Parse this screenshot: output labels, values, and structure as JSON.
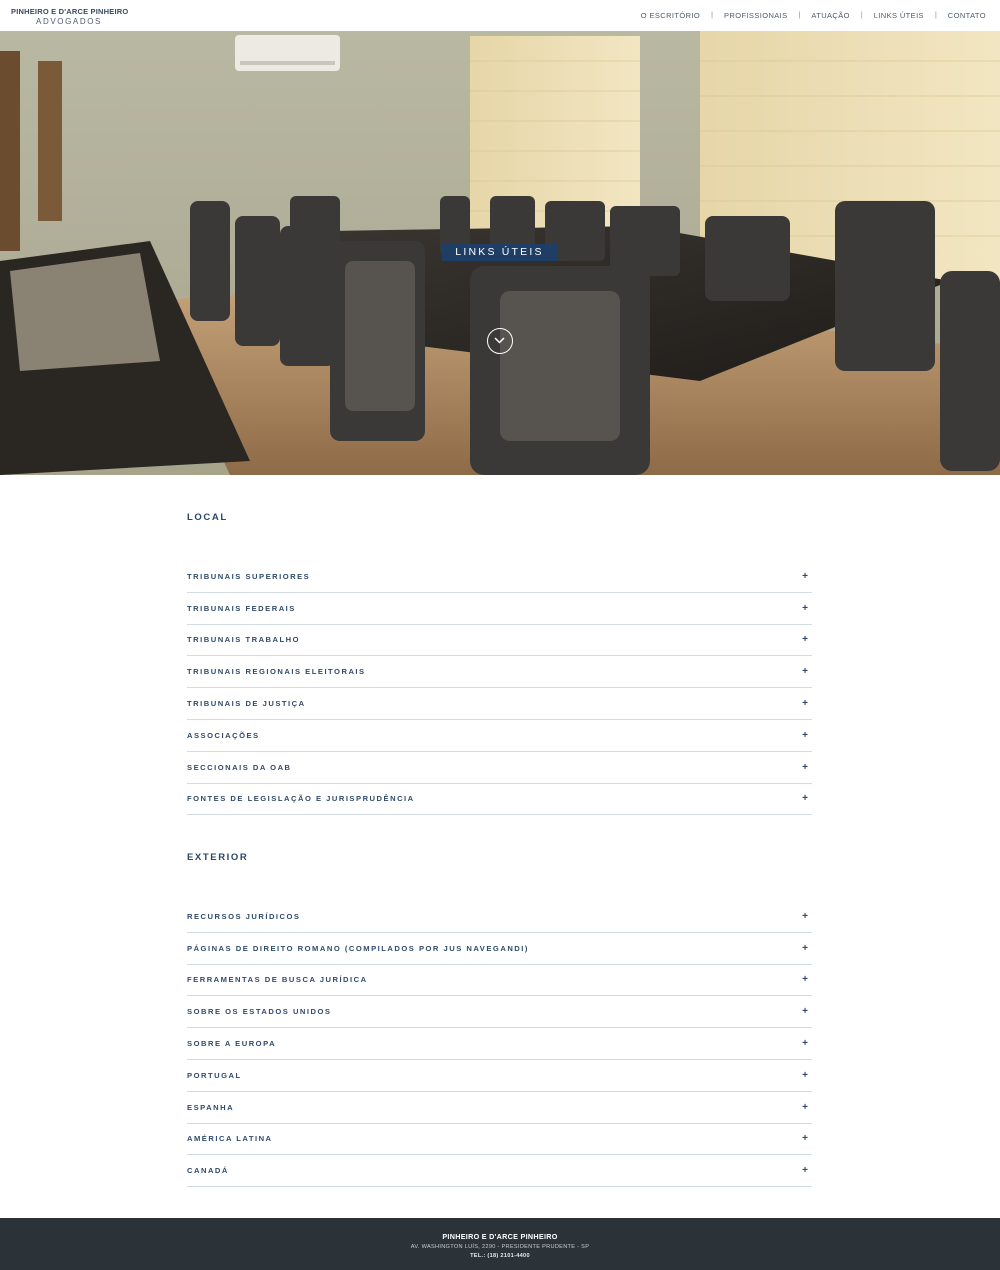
{
  "header": {
    "logo_name": "PINHEIRO E D'ARCE PINHEIRO",
    "logo_sub": "ADVOGADOS",
    "nav": [
      "O ESCRITÓRIO",
      "PROFISSIONAIS",
      "ATUAÇÃO",
      "LINKS ÚTEIS",
      "CONTATO"
    ],
    "separator": "|"
  },
  "hero": {
    "title": "LINKS ÚTEIS",
    "scroll_icon": "chevron-down-icon"
  },
  "local": {
    "title": "LOCAL",
    "items": [
      "TRIBUNAIS SUPERIORES",
      "TRIBUNAIS FEDERAIS",
      "TRIBUNAIS TRABALHO",
      "TRIBUNAIS REGIONAIS ELEITORAIS",
      "TRIBUNAIS DE JUSTIÇA",
      "ASSOCIAÇÕES",
      "SECCIONAIS DA OAB",
      "FONTES DE LEGISLAÇÃO E JURISPRUDÊNCIA"
    ]
  },
  "exterior": {
    "title": "EXTERIOR",
    "items": [
      "RECURSOS JURÍDICOS",
      "PÁGINAS DE DIREITO ROMANO (COMPILADOS POR JUS NAVEGANDI)",
      "FERRAMENTAS DE BUSCA JURÍDICA",
      "SOBRE OS ESTADOS UNIDOS",
      "SOBRE A EUROPA",
      "PORTUGAL",
      "ESPANHA",
      "AMÉRICA LATINA",
      "CANADÁ"
    ]
  },
  "accordion": {
    "expand_symbol": "+",
    "icon": "plus-icon"
  },
  "footer": {
    "name": "PINHEIRO E D'ARCE PINHEIRO",
    "address": "AV. WASHINGTON LUÍS, 2290 - PRESIDENTE PRUDENTE - SP",
    "phone": "TEL.: (18) 2101-4400"
  },
  "colors": {
    "brand_navy": "#1f3e66",
    "text_navy": "#2f4a6e",
    "footer_bg": "#2b3339",
    "divider": "#d3dbe4"
  }
}
